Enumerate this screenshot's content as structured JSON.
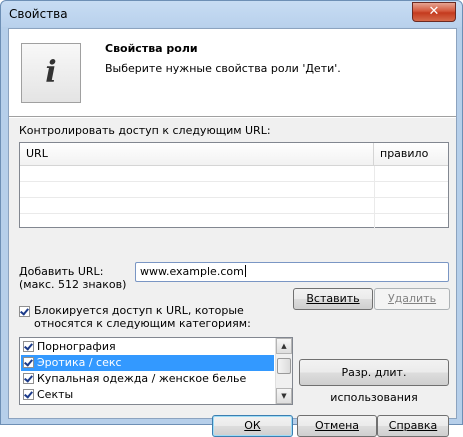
{
  "window": {
    "title": "Свойства",
    "close_glyph": "✕"
  },
  "header": {
    "icon_glyph": "i",
    "title": "Свойства роли",
    "subtitle": "Выберите нужные свойства роли 'Дети'."
  },
  "url_section": {
    "label": "Контролировать доступ к следующим URL:",
    "columns": [
      "URL",
      "правило"
    ],
    "rows": []
  },
  "add_url": {
    "label_line1": "Добавить URL:",
    "label_line2": "(макс. 512 знаков)",
    "value": "www.example.com",
    "insert_label": "Вставить",
    "delete_label": "Удалить"
  },
  "block": {
    "checked": true,
    "label_line1": "Блокируется доступ к URL, которые",
    "label_line2": "относятся к следующим категориям:"
  },
  "categories": [
    {
      "label": "Порнография",
      "checked": true,
      "selected": false
    },
    {
      "label": "Эротика / секс",
      "checked": true,
      "selected": true
    },
    {
      "label": "Купальная одежда / женское белье",
      "checked": true,
      "selected": false
    },
    {
      "label": "Секты",
      "checked": true,
      "selected": false
    }
  ],
  "usage_button": "Разр. длит. использования",
  "footer": {
    "ok": "ОК",
    "cancel": "Отмена",
    "help": "Справка"
  },
  "icons": {
    "scroll_up": "▲",
    "scroll_down": "▼"
  }
}
